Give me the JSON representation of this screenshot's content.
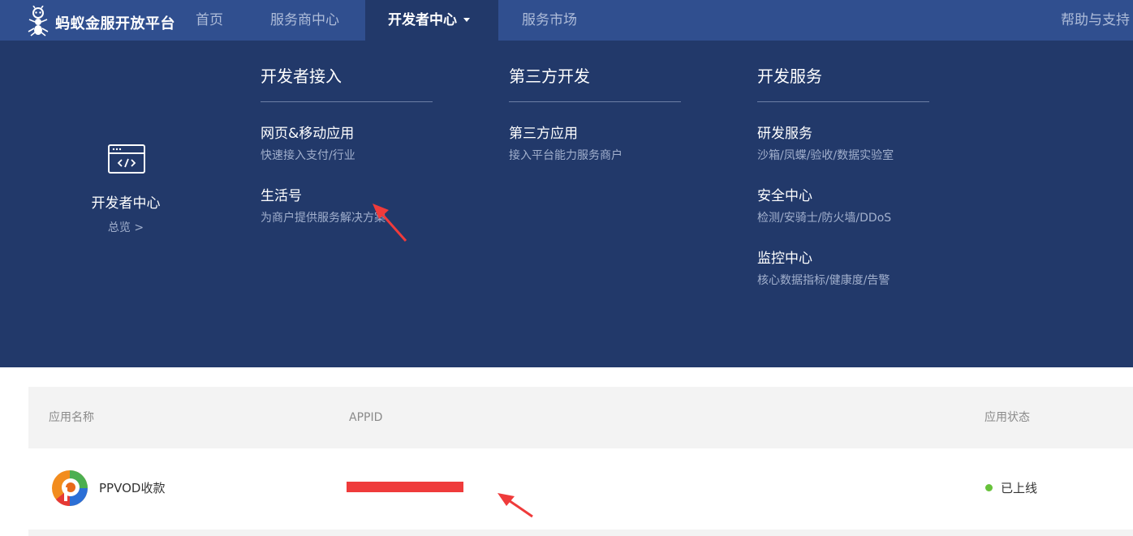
{
  "nav": {
    "logo_text": "蚂蚁金服开放平台",
    "items": [
      {
        "label": "首页"
      },
      {
        "label": "服务商中心"
      },
      {
        "label": "开发者中心",
        "active": true
      },
      {
        "label": "服务市场"
      }
    ],
    "help": "帮助与支持"
  },
  "mega_menu": {
    "side": {
      "icon": "code-window-icon",
      "title": "开发者中心",
      "link": "总览 >"
    },
    "columns": [
      {
        "heading": "开发者接入",
        "items": [
          {
            "title": "网页&移动应用",
            "desc": "快速接入支付/行业"
          },
          {
            "title": "生活号",
            "desc": "为商户提供服务解决方案"
          }
        ]
      },
      {
        "heading": "第三方开发",
        "items": [
          {
            "title": "第三方应用",
            "desc": "接入平台能力服务商户"
          }
        ]
      },
      {
        "heading": "开发服务",
        "items": [
          {
            "title": "研发服务",
            "desc": "沙箱/凤蝶/验收/数据实验室"
          },
          {
            "title": "安全中心",
            "desc": "检测/安骑士/防火墙/DDoS"
          },
          {
            "title": "监控中心",
            "desc": "核心数据指标/健康度/告警"
          }
        ]
      }
    ]
  },
  "table": {
    "headers": [
      "应用名称",
      "APPID",
      "应用状态"
    ],
    "rows": [
      {
        "name": "PPVOD收款",
        "appid": "",
        "status": "已上线",
        "status_color": "#67c23a"
      }
    ]
  },
  "colors": {
    "nav_bg": "#304f8f",
    "menu_bg": "#22396a",
    "annotation_red": "#ef3b3b"
  }
}
